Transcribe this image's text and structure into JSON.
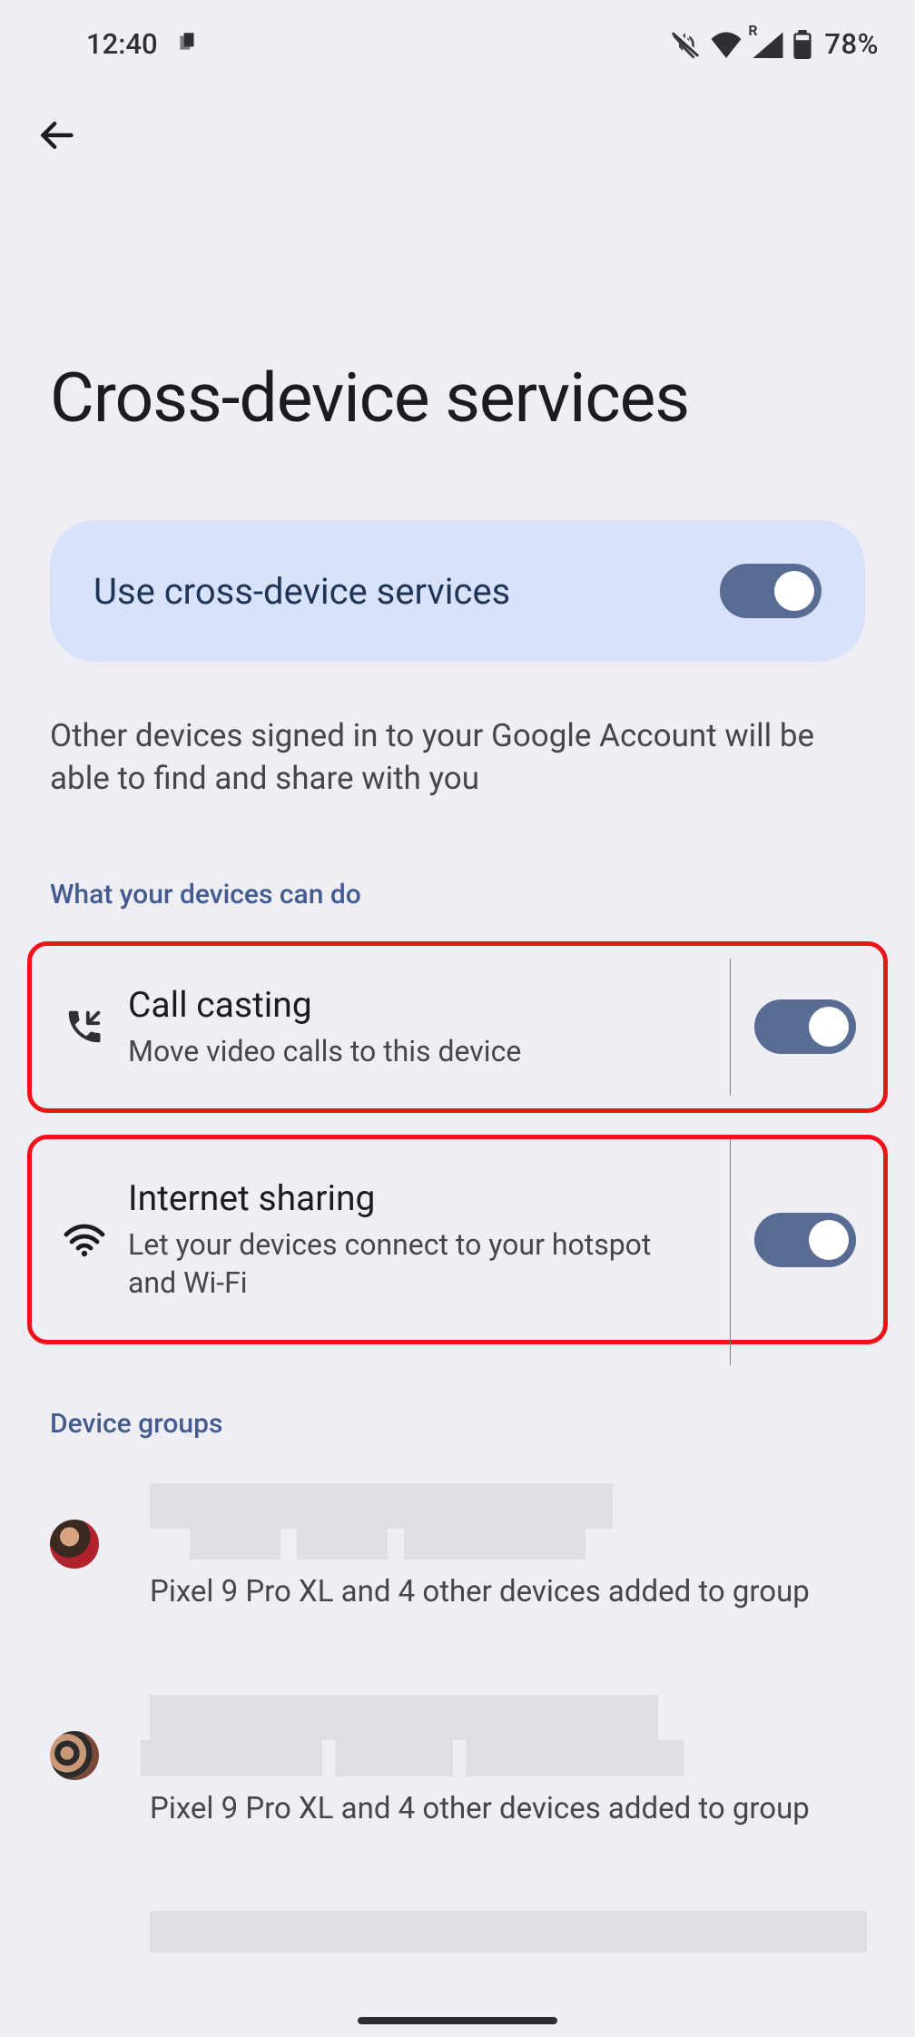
{
  "status": {
    "time": "12:40",
    "battery": "78%",
    "roaming_letter": "R"
  },
  "page": {
    "title": "Cross-device services"
  },
  "master_toggle": {
    "label": "Use cross-device services",
    "enabled": true
  },
  "description": "Other devices signed in to your Google Account will be able to find and share with you",
  "section_capabilities_header": "What your devices can do",
  "capabilities": {
    "call_casting": {
      "title": "Call casting",
      "subtitle": "Move video calls to this device",
      "enabled": true
    },
    "internet_sharing": {
      "title": "Internet sharing",
      "subtitle": "Let your devices connect to your hotspot and Wi-Fi",
      "enabled": true
    }
  },
  "section_groups_header": "Device groups",
  "groups": [
    {
      "subtitle": "Pixel 9 Pro XL and 4 other devices added to group"
    },
    {
      "subtitle": "Pixel 9 Pro XL and 4 other devices added to group"
    }
  ]
}
